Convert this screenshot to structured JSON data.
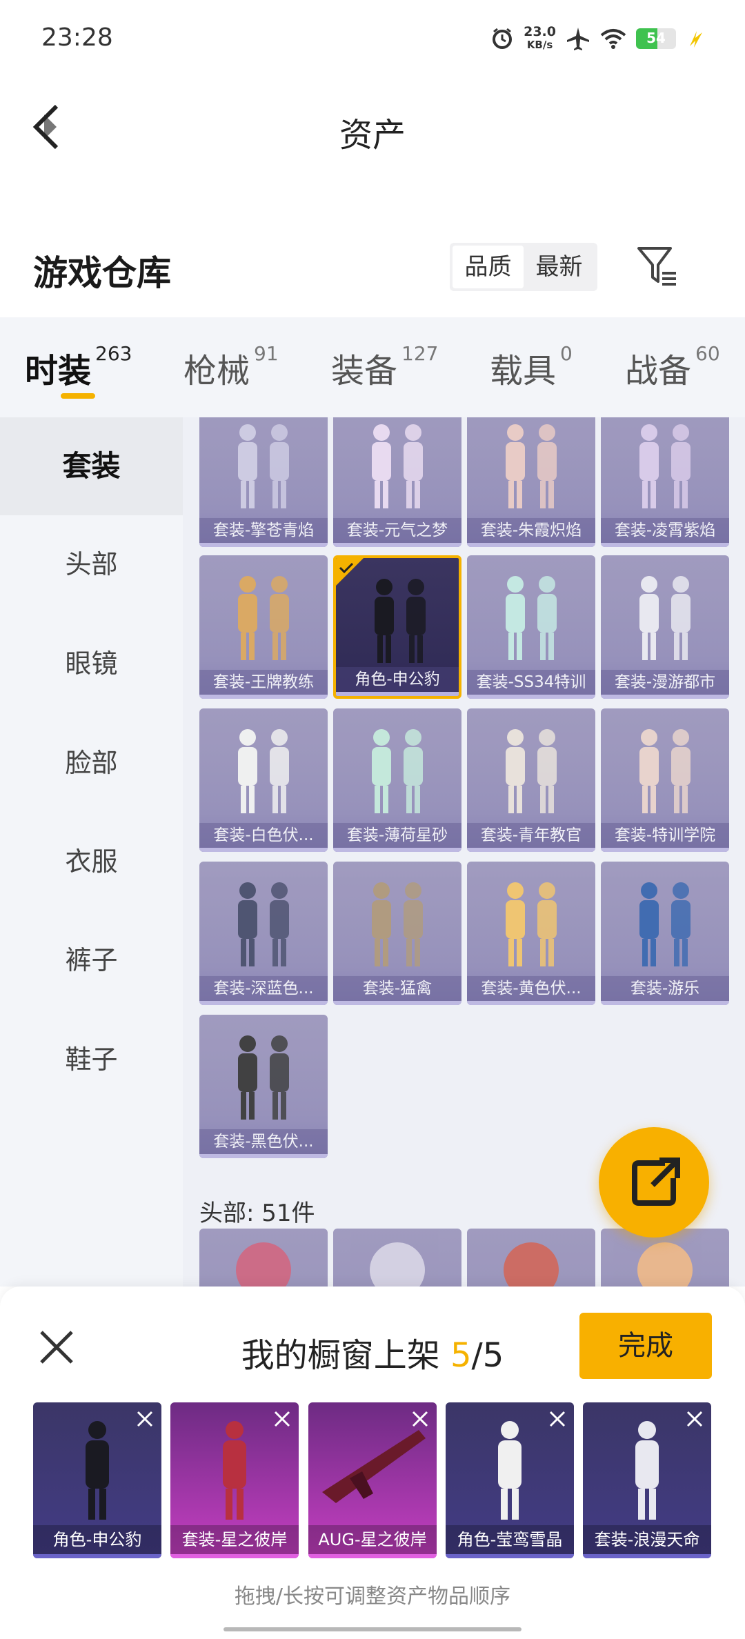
{
  "status": {
    "time": "23:28",
    "net_speed_value": "23.0",
    "net_speed_unit": "KB/s",
    "battery": "54",
    "battery_level": 0.54
  },
  "header": {
    "title": "资产"
  },
  "warehouse": {
    "title": "游戏仓库",
    "sort_options": [
      "品质",
      "最新"
    ],
    "active_sort": "品质"
  },
  "tabs": [
    {
      "label": "时装",
      "count": "263"
    },
    {
      "label": "枪械",
      "count": "91"
    },
    {
      "label": "装备",
      "count": "127"
    },
    {
      "label": "载具",
      "count": "0"
    },
    {
      "label": "战备",
      "count": "60"
    }
  ],
  "sidebar": {
    "items": [
      "套装",
      "头部",
      "眼镜",
      "脸部",
      "衣服",
      "裤子",
      "鞋子"
    ],
    "active": "套装"
  },
  "grid": {
    "items": [
      "套装-擎苍青焰",
      "套装-元气之梦",
      "套装-朱霞炽焰",
      "套装-凌霄紫焰",
      "套装-王牌教练",
      "角色-申公豹",
      "套装-SS34特训",
      "套装-漫游都市",
      "套装-白色伏...",
      "套装-薄荷星砂",
      "套装-青年教官",
      "套装-特训学院",
      "套装-深蓝色...",
      "套装-猛禽",
      "套装-黄色伏...",
      "套装-游乐",
      "套装-黑色伏..."
    ],
    "selected": "角色-申公豹",
    "next_section_label": "头部: 51件"
  },
  "showcase": {
    "title_prefix": "我的橱窗上架 ",
    "count_current": "5",
    "count_sep": "/5",
    "done_label": "完成",
    "items": [
      {
        "label": "角色-申公豹",
        "style": "blue"
      },
      {
        "label": "套装-星之彼岸",
        "style": "pink"
      },
      {
        "label": "AUG-星之彼岸",
        "style": "pink"
      },
      {
        "label": "角色-莹鸾雪晶",
        "style": "blue"
      },
      {
        "label": "套装-浪漫天命",
        "style": "blue"
      }
    ],
    "hint": "拖拽/长按可调整资产物品顺序"
  },
  "colors": {
    "accent": "#f8b000",
    "card": "#8f89b6",
    "card_selected_border": "#f5b200",
    "pink_card": "#c63fc2"
  },
  "icons": [
    "back-arrow-icon",
    "filter-icon",
    "share-icon",
    "close-icon",
    "check-icon",
    "alarm-icon",
    "airplane-icon",
    "wifi-icon",
    "battery-icon",
    "charging-icon"
  ]
}
